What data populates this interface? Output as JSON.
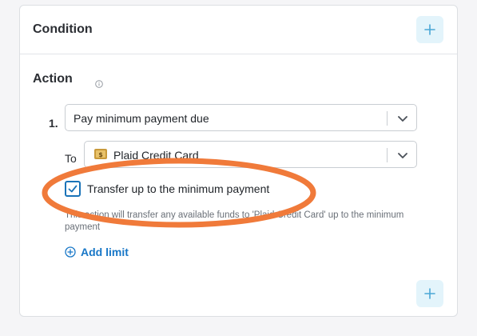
{
  "condition": {
    "title": "Condition",
    "add_icon": "plus-icon"
  },
  "action": {
    "title": "Action",
    "info_icon": "info-icon",
    "step_number": "1.",
    "action_select": {
      "value": "Pay minimum payment due",
      "icon": "chevron-down-icon"
    },
    "to_label": "To",
    "target_select": {
      "value": "Plaid Credit Card",
      "icon": "bank-icon"
    },
    "checkbox": {
      "checked": true,
      "label": "Transfer up to the minimum payment"
    },
    "helper_text": "This action will transfer any available funds to 'Plaid Credit Card' up to the minimum payment",
    "add_limit_label": "Add limit",
    "add_icon": "plus-icon"
  },
  "colors": {
    "accent": "#1877c7",
    "plus_button_bg": "#e3f4fb",
    "annotation_ring": "#f07a3a"
  }
}
